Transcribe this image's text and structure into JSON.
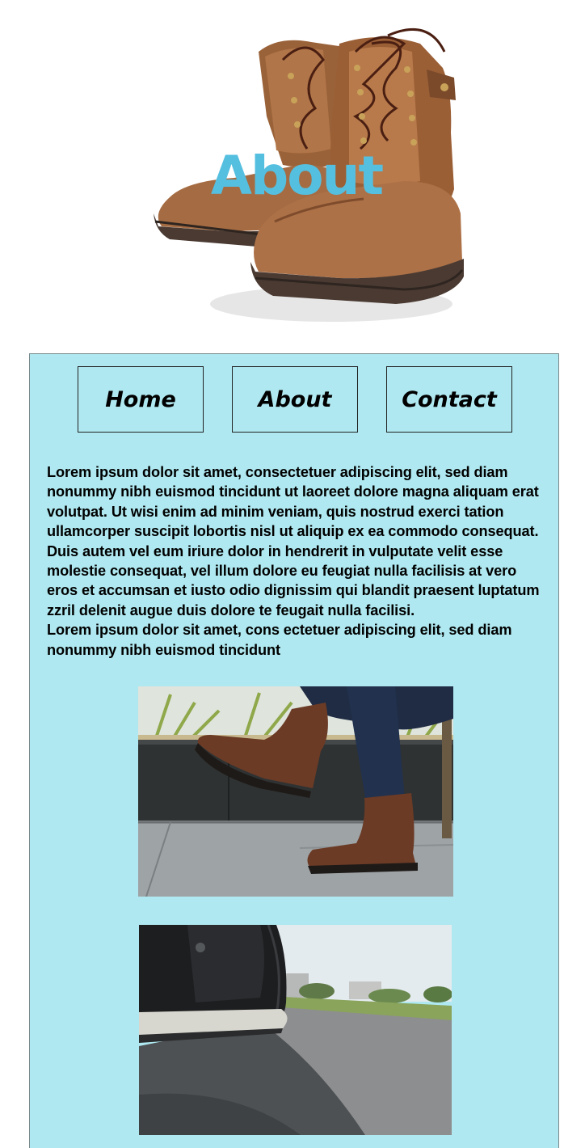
{
  "hero": {
    "title": "About",
    "title_color": "#55bfe0",
    "image": "brown-leather-boots-image"
  },
  "nav": {
    "items": [
      {
        "label": "Home"
      },
      {
        "label": "About"
      },
      {
        "label": "Contact"
      }
    ]
  },
  "content": {
    "paragraph_1": "Lorem ipsum dolor sit amet, consectetuer adipiscing elit, sed diam nonummy nibh euismod tincidunt ut laoreet dolore magna aliquam erat volutpat. Ut wisi enim ad minim veniam, quis nostrud exerci tation ullamcorper suscipit lobortis nisl ut aliquip ex ea commodo consequat. Duis autem vel eum iriure dolor in hendrerit in vulputate velit esse molestie consequat, vel illum dolore eu feugiat nulla facilisis at vero eros et accumsan et iusto odio dignissim qui blandit praesent luptatum zzril delenit augue duis dolore te feugait nulla facilisi.",
    "paragraph_2": "Lorem ipsum dolor sit amet, cons ectetuer adipiscing elit, sed diam nonummy nibh euismod tincidunt"
  },
  "photos": [
    {
      "subject": "person-in-brown-boots-photo"
    },
    {
      "subject": "black-sneaker-on-road-photo"
    }
  ],
  "colors": {
    "panel_background": "#afe8f0",
    "panel_border": "#7a8a8c",
    "accent": "#55bfe0"
  }
}
